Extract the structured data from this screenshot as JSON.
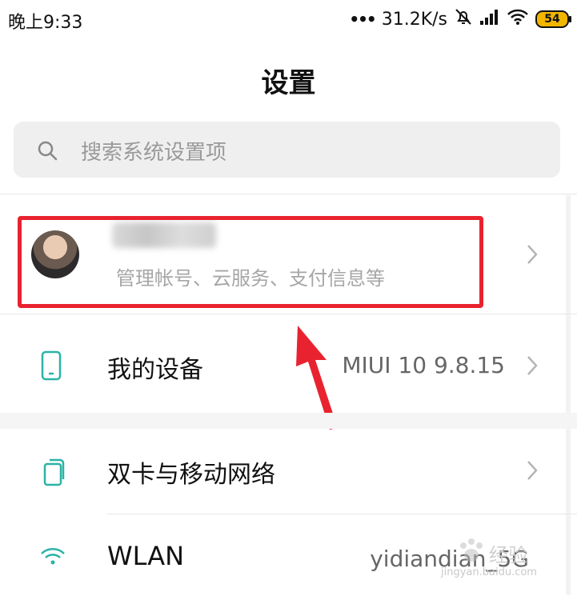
{
  "status_bar": {
    "time": "晚上9:33",
    "speed": "31.2K/s",
    "battery": "54",
    "dots": "•••"
  },
  "header": {
    "title": "设置"
  },
  "search": {
    "placeholder": "搜索系统设置项"
  },
  "account": {
    "subtitle": "管理帐号、云服务、支付信息等"
  },
  "rows": [
    {
      "label": "我的设备",
      "value": "MIUI 10 9.8.15",
      "icon": "phone-icon"
    },
    {
      "label": "双卡与移动网络",
      "value": "",
      "icon": "sim-card-icon"
    },
    {
      "label": "WLAN",
      "value": "yidiandian_5G",
      "icon": "wifi-icon"
    }
  ],
  "watermark": {
    "title": "经验",
    "url": "jingyan.baidu.com"
  },
  "colors": {
    "accent": "#2bb3a6",
    "highlight": "#e8232f"
  }
}
